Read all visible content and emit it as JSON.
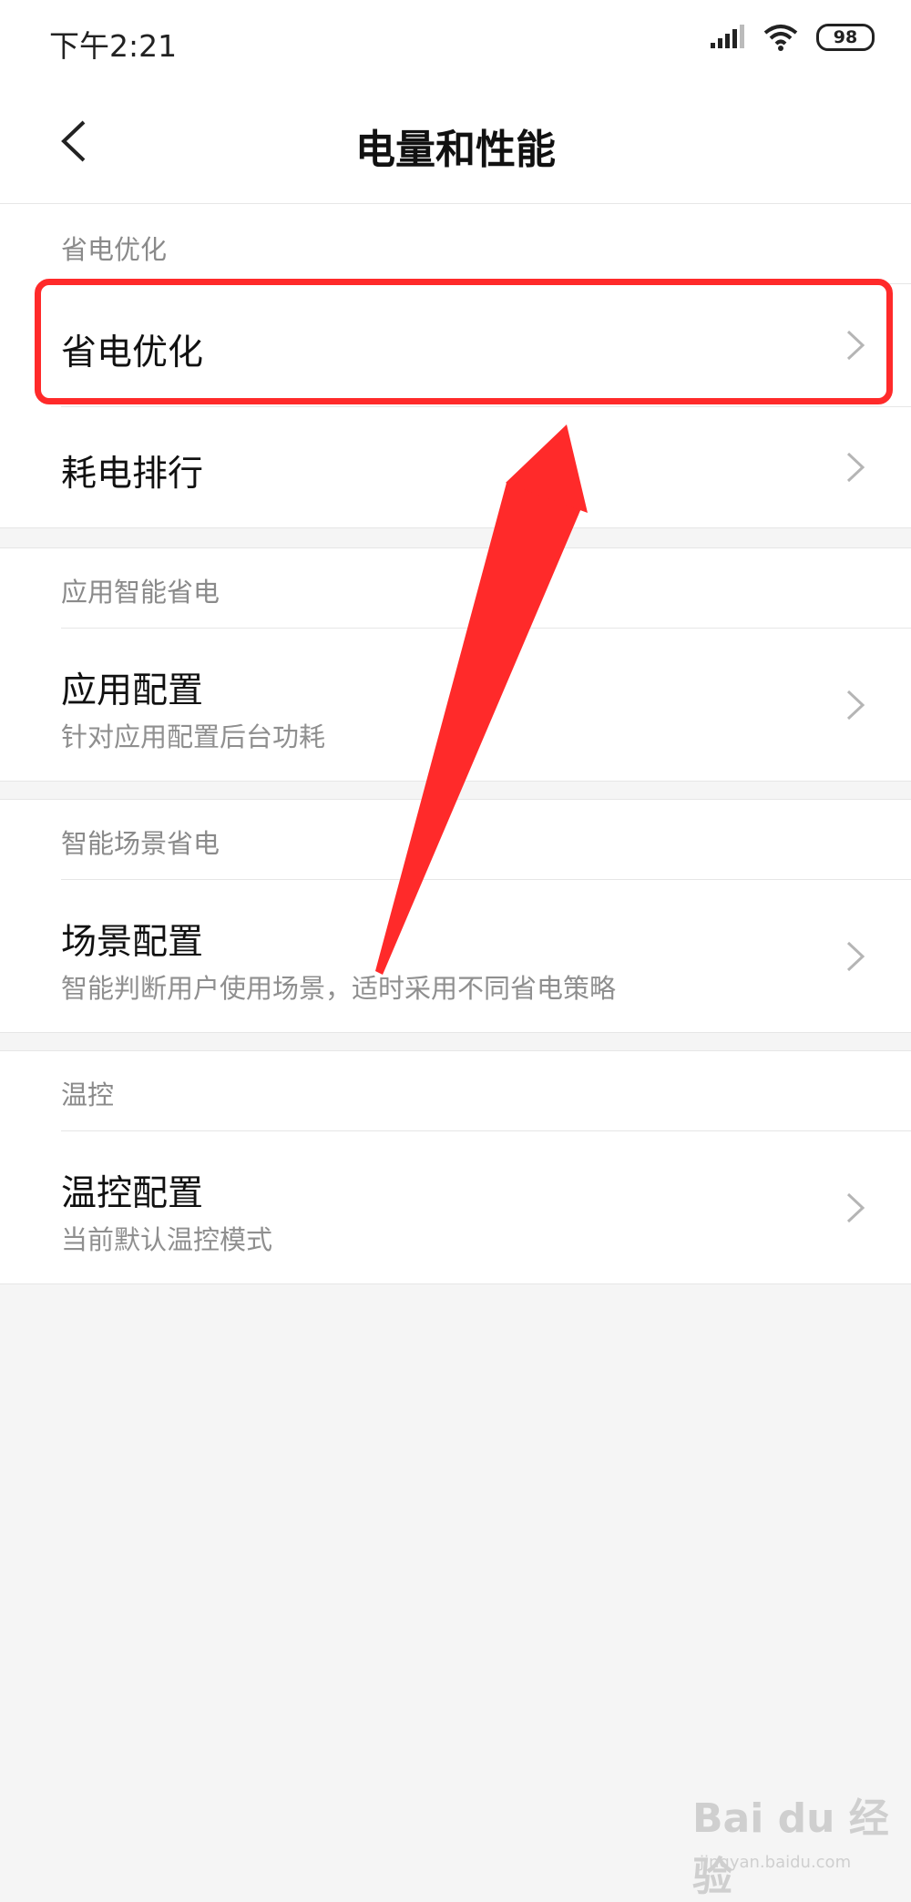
{
  "status_bar": {
    "time": "下午2:21",
    "battery": "98"
  },
  "header": {
    "title": "电量和性能"
  },
  "sections": [
    {
      "header": "省电优化",
      "items": [
        {
          "title": "省电优化"
        },
        {
          "title": "耗电排行"
        }
      ]
    },
    {
      "header": "应用智能省电",
      "items": [
        {
          "title": "应用配置",
          "subtitle": "针对应用配置后台功耗"
        }
      ]
    },
    {
      "header": "智能场景省电",
      "items": [
        {
          "title": "场景配置",
          "subtitle": "智能判断用户使用场景，适时采用不同省电策略"
        }
      ]
    },
    {
      "header": "温控",
      "items": [
        {
          "title": "温控配置",
          "subtitle": "当前默认温控模式"
        }
      ]
    }
  ],
  "watermark": {
    "brand": "Bai du 经验",
    "url": "jingyan.baidu.com"
  },
  "colors": {
    "annotation": "#ff2a2a",
    "background": "#f5f5f5"
  },
  "icons": {
    "back": "chevron-left-icon",
    "chevron": "chevron-right-icon",
    "signal": "signal-icon",
    "wifi": "wifi-icon"
  }
}
